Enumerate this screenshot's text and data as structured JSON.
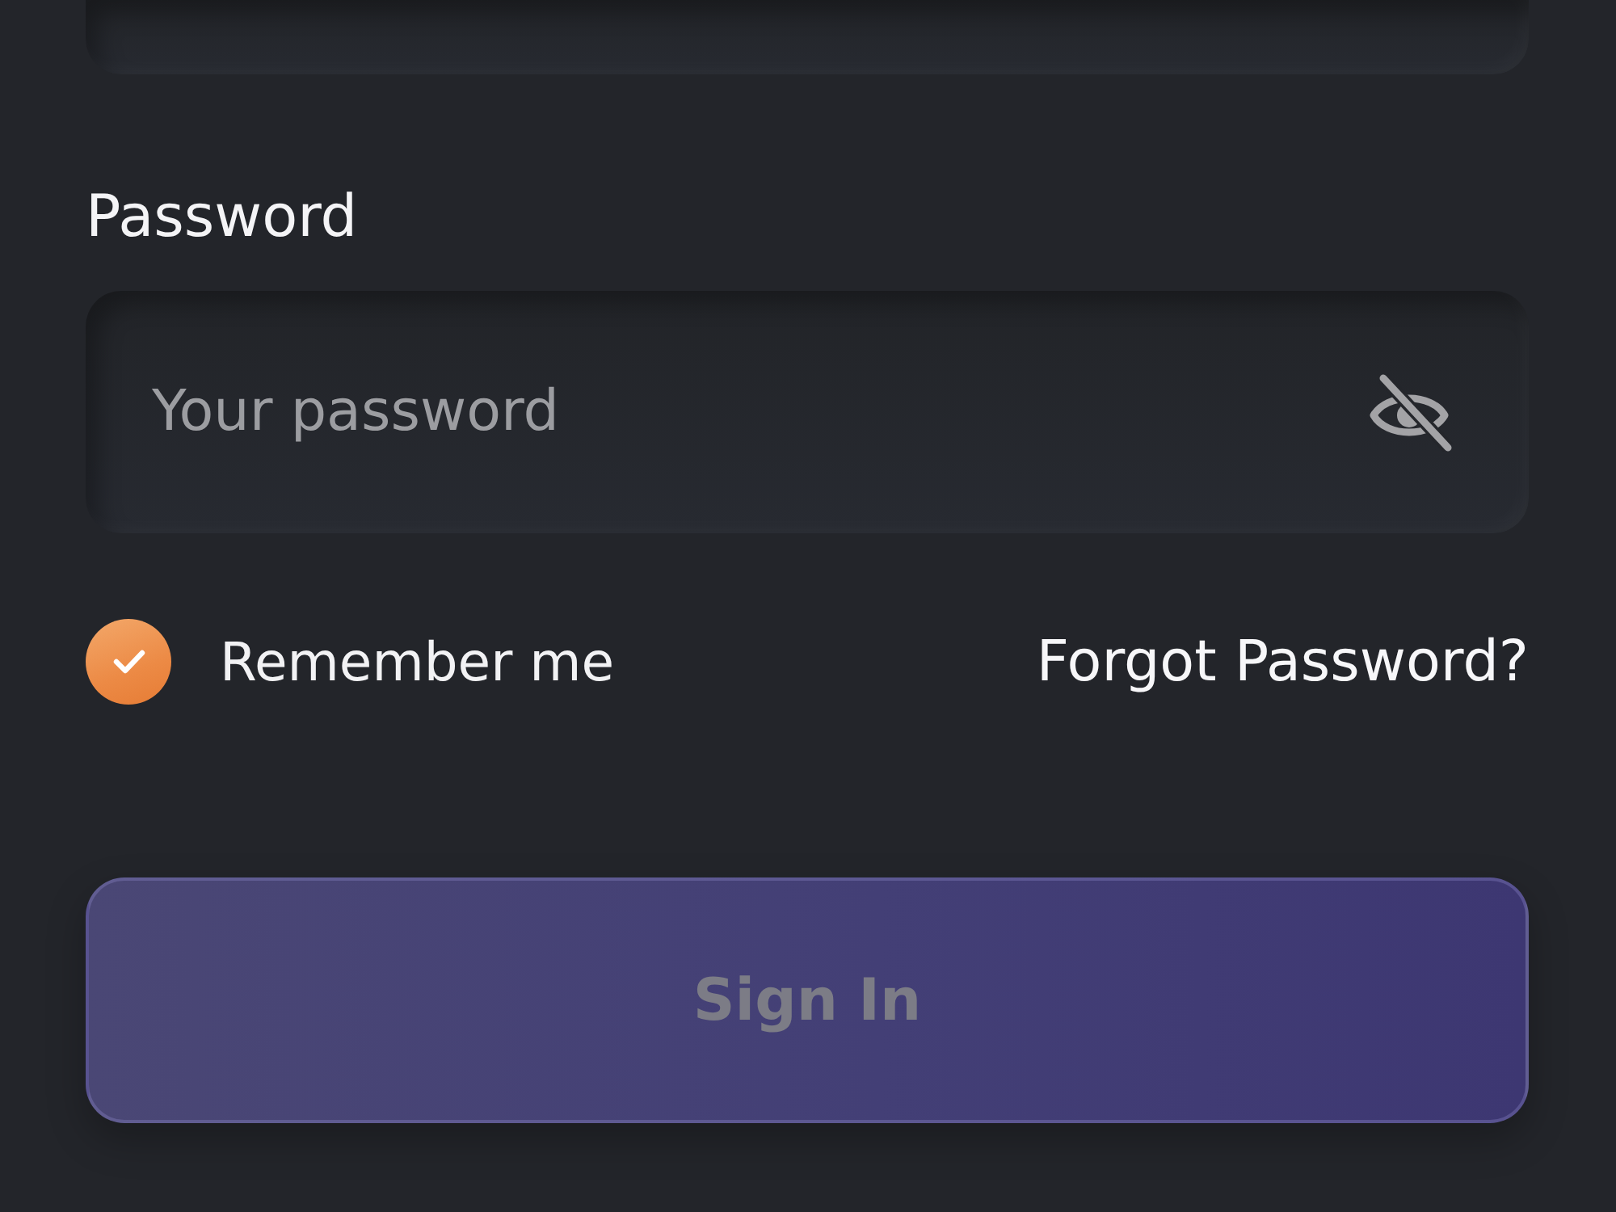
{
  "password": {
    "label": "Password",
    "placeholder": "Your password",
    "visible": false
  },
  "remember": {
    "label": "Remember me",
    "checked": true
  },
  "forgot_link": "Forgot Password?",
  "sign_in": {
    "label": "Sign In",
    "disabled": true
  }
}
